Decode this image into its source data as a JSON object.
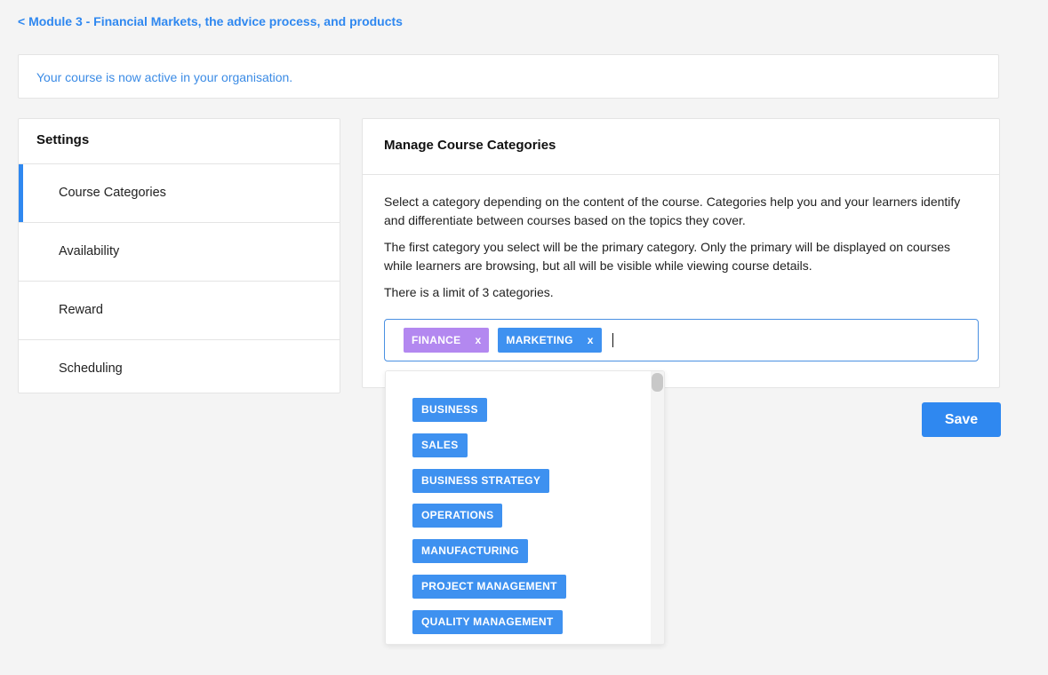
{
  "breadcrumb": {
    "back_label": "< Module 3 - Financial Markets, the advice process, and products"
  },
  "alert": {
    "message": "Your course is now active in your organisation."
  },
  "settings": {
    "title": "Settings",
    "items": [
      {
        "label": "Course Categories",
        "active": true
      },
      {
        "label": "Availability",
        "active": false
      },
      {
        "label": "Reward",
        "active": false
      },
      {
        "label": "Scheduling",
        "active": false
      }
    ]
  },
  "manage": {
    "title": "Manage Course Categories",
    "paragraphs": [
      "Select a category depending on the content of the course. Categories help you and your learners identify and differentiate between courses based on the topics they cover.",
      "The first category you select will be the primary category. Only the primary will be displayed on courses while learners are browsing, but all will be visible while viewing course details.",
      "There is a limit of 3 categories."
    ],
    "selected": [
      {
        "label": "FINANCE",
        "remove": "x",
        "color": "#b388f0"
      },
      {
        "label": "MARKETING",
        "remove": "x",
        "color": "#3e91f0"
      }
    ]
  },
  "dropdown": {
    "options": [
      "BUSINESS",
      "SALES",
      "BUSINESS STRATEGY",
      "OPERATIONS",
      "MANUFACTURING",
      "PROJECT MANAGEMENT",
      "QUALITY MANAGEMENT"
    ]
  },
  "actions": {
    "save_label": "Save"
  },
  "colors": {
    "accent": "#2f88f0",
    "chip_blue": "#3e91f0",
    "chip_purple": "#b388f0"
  }
}
